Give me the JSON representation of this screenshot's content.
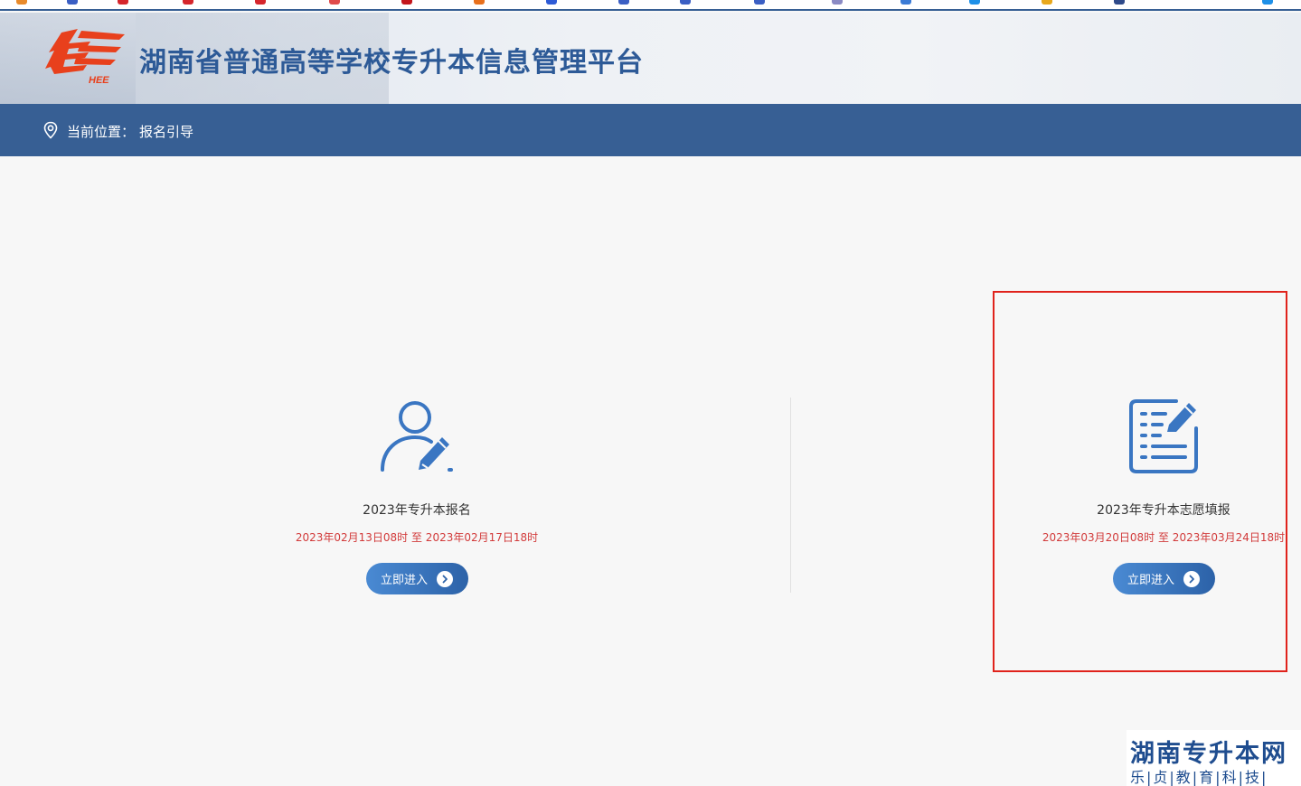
{
  "header": {
    "site_title": "湖南省普通高等学校专升本信息管理平台",
    "logo_text": "HEE"
  },
  "location_bar": {
    "label": "当前位置：",
    "current": "报名引导"
  },
  "cards": [
    {
      "title": "2023年专升本报名",
      "time": "2023年02月13日08时 至 2023年02月17日18时",
      "button": "立即进入",
      "icon": "user-edit-icon"
    },
    {
      "title": "2023年专升本志愿填报",
      "time": "2023年03月20日08时 至 2023年03月24日18时",
      "button": "立即进入",
      "icon": "document-edit-icon"
    }
  ],
  "watermark": {
    "title": "湖南专升本网",
    "subtitle": "乐|贞|教|育|科|技|"
  },
  "colors": {
    "brand_blue": "#375f94",
    "title_blue": "#2d5a97",
    "accent_red": "#d23b3b",
    "highlight_red": "#e0231c",
    "logo_orange": "#e8401c"
  }
}
